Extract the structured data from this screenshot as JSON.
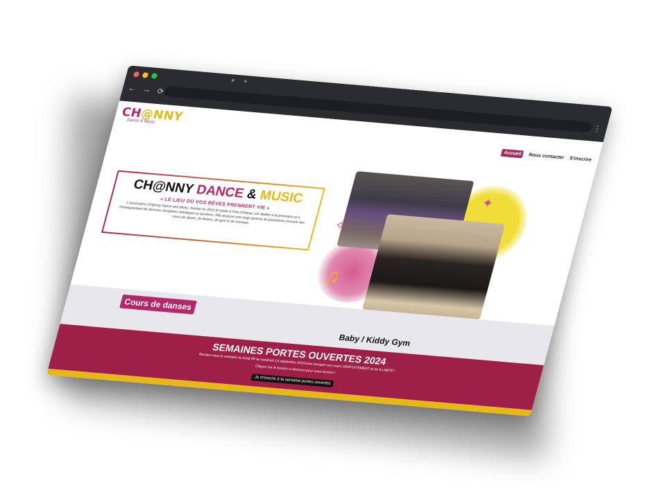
{
  "browser": {
    "tab_close": "×",
    "tab_new": "+",
    "nav_back": "←",
    "nav_forward": "→",
    "nav_reload": "⟳",
    "menu": "⋮"
  },
  "logo": {
    "main_a": "CH",
    "main_b": "@NNY",
    "tagline": "Dance & Music"
  },
  "nav": {
    "items": [
      "Accueil",
      "Nous contacter",
      "S'inscrire"
    ],
    "active_index": 0
  },
  "hero": {
    "title_part1": "CH@NNY ",
    "title_part2": "DANCE",
    "title_part3": " & ",
    "title_part4": "MUSIC",
    "subtitle": "« LE LIEU OÙ VOS RÊVES PRENNENT VIE »",
    "description": "L'association Ch@nny Dance and Music, fondée en 2022 et située à l'Isle d'Abeau, est dédiée à la promotion et à l'enseignement de diverses disciplines artistiques et sportives. Elle propose une large gamme de prestations incluant des cours de danse, de fitness, de gym et de musique."
  },
  "sections": {
    "cours_label": "Cours de danses",
    "baby_label": "Baby / Kiddy Gym"
  },
  "portes_ouvertes": {
    "title": "SEMAINES PORTES OUVERTES 2024",
    "line1": "Rendez-vous la semaine du lundi 09 au vendredi 13 septembre 2024 pour essayer nos cours GRATUITEMENT et en ILLIMITÉ !",
    "line2": "Cliquez sur le bouton ci-dessous pour vous inscrire !",
    "button": "Je m'inscris à la semaine portes ouvertes"
  },
  "colors": {
    "brand_pink": "#b3276b",
    "brand_yellow": "#e6b817",
    "band_red": "#9e2048",
    "chrome_dark": "#2b2c30"
  },
  "icons": [
    "music-note-icon",
    "dancer-icon",
    "microphone-icon"
  ]
}
